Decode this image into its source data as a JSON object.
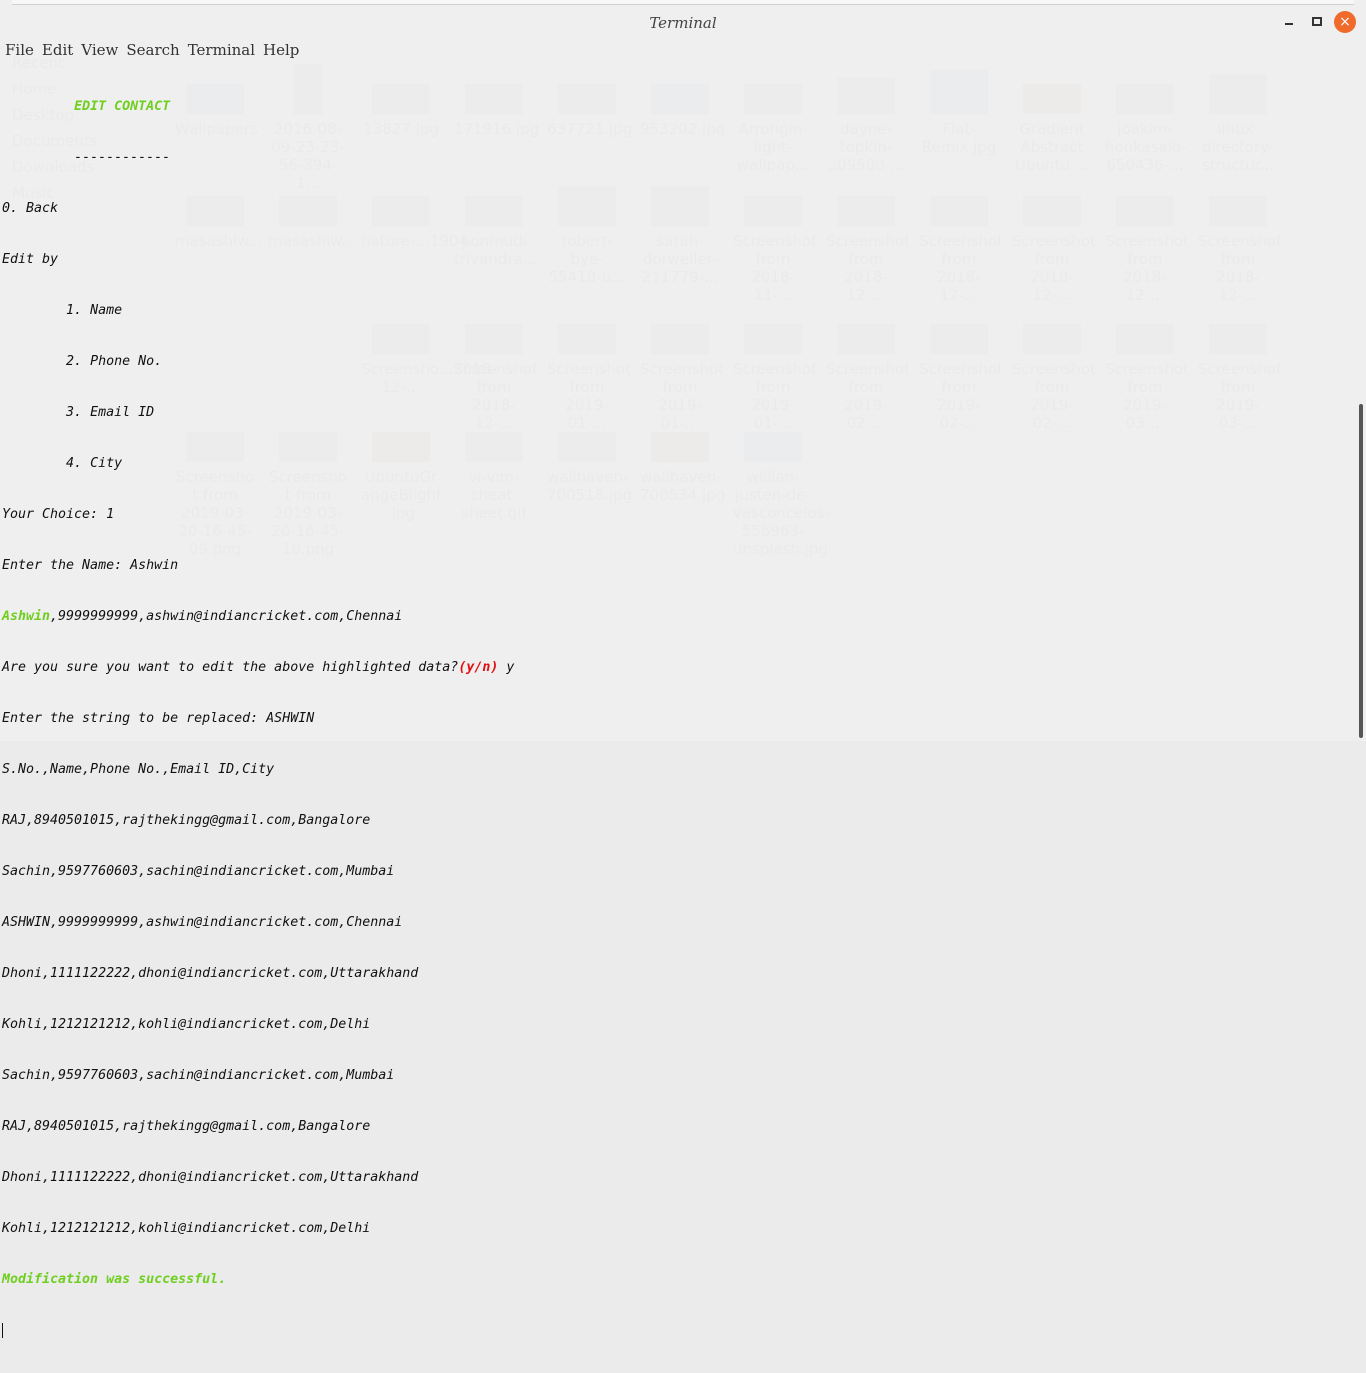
{
  "window": {
    "title": "Terminal"
  },
  "window_controls": {
    "minimize": "minimize-icon",
    "maximize": "maximize-icon",
    "close": "×"
  },
  "menu": [
    "File",
    "Edit",
    "View",
    "Search",
    "Terminal",
    "Help"
  ],
  "terminal": {
    "heading": "EDIT CONTACT",
    "underline": "------------",
    "back": "0. Back",
    "edit_by": "Edit by",
    "options": [
      "1. Name",
      "2. Phone No.",
      "3. Email ID",
      "4. City"
    ],
    "choice": "Your Choice: 1",
    "enter_name": "Enter the Name: Ashwin",
    "highlight_name": "Ashwin",
    "highlight_rest": ",9999999999,ashwin@indiancricket.com,Chennai",
    "confirm_q": "Are you sure you want to edit the above highlighted data?",
    "confirm_yn": "(y/n)",
    "confirm_ans": " y",
    "replace_prompt": "Enter the string to be replaced: ASHWIN",
    "records": [
      "S.No.,Name,Phone No.,Email ID,City",
      "RAJ,8940501015,rajthekingg@gmail.com,Bangalore",
      "Sachin,9597760603,sachin@indiancricket.com,Mumbai",
      "ASHWIN,9999999999,ashwin@indiancricket.com,Chennai",
      "Dhoni,1111122222,dhoni@indiancricket.com,Uttarakhand",
      "Kohli,1212121212,kohli@indiancricket.com,Delhi",
      "Sachin,9597760603,sachin@indiancricket.com,Mumbai",
      "RAJ,8940501015,rajthekingg@gmail.com,Bangalore",
      "Dhoni,1111122222,dhoni@indiancricket.com,Uttarakhand",
      "Kohli,1212121212,kohli@indiancricket.com,Delhi"
    ],
    "success": "Modification was successful."
  },
  "background_files": {
    "sidebar": [
      "Recent",
      "Home",
      "Desktop",
      "Documents",
      "Downloads",
      "Music"
    ],
    "tiles": [
      [
        "Wallpapers",
        "2016-08-09-23-23-56-394-1...",
        "13827.jpg",
        "171916.jpg",
        "637721.jpg",
        "953202.jpg",
        "Arrongin-light-wallpap...",
        "dayne-topkin-309500-...",
        "Flat-Remix.jpg",
        "Gradient Abstract Ubuntu ...",
        "joakim-honkasalo-650436-...",
        "linux-directory-structur..."
      ],
      [
        "masashiw...",
        "masashiw...",
        "nature-...1904...",
        "ponmudi trivandra...",
        "robert-bye-55418-u...",
        "sarah-dorweiler-211779-...",
        "Screenshot from 2018-11-...",
        "Screenshot from 2018-12-...",
        "Screenshot from 2018-12-...",
        "Screenshot from 2018-12-...",
        "Screenshot from 2018-12-...",
        "Screenshot from 2018-12-..."
      ],
      [
        "Screensho...2018-12-...",
        "Screenshot from 2018-12-...",
        "Screenshot from 2019-01-...",
        "Screenshot from 2019-01-...",
        "Screenshot from 2019-01-...",
        "Screenshot from 2019-02-...",
        "Screenshot from 2019-02-...",
        "Screenshot from 2019-02-...",
        "Screenshot from 2019-03-...",
        "Screenshot from 2019-03-..."
      ],
      [
        "Screensho t from 2019-03-20-16-45-09.png",
        "Screensho t from 2019-03-20-16-45-18.png",
        "UbuntuGr angeBlight .jpg",
        "vi-vim-cheat-sheet.gif",
        "wallhaven-700518.jpg",
        "wallhaven-700534.jpg",
        "willian-justen-de-vasconcelos-556963-unsplash.jpg"
      ]
    ]
  }
}
